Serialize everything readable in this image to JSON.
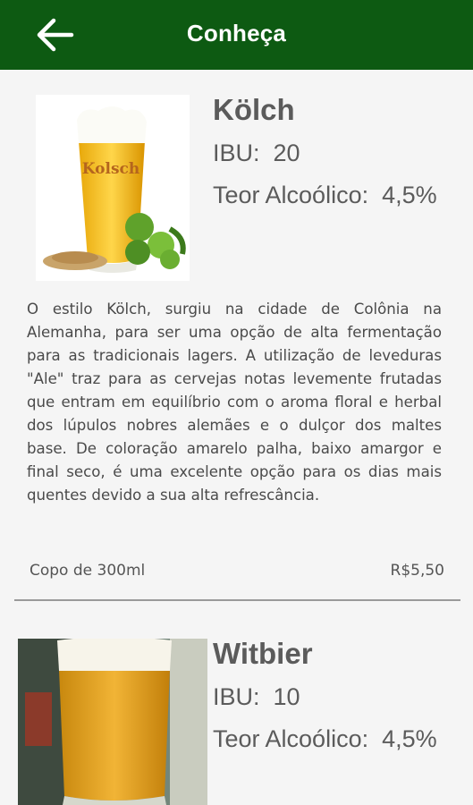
{
  "appbar": {
    "title": "Conheça"
  },
  "beers": [
    {
      "name": "Kölch",
      "ibu_label": "IBU:",
      "ibu_value": "20",
      "abv_label": "Teor Alcoólico:",
      "abv_value": "4,5%",
      "glass_text": "Kolsch",
      "description": "O estilo Kölch, surgiu na cidade de Colônia na Alemanha, para ser uma opção de alta fermentação para as tradicionais lagers. A utilização de leveduras \"Ale\" traz para as cervejas notas levemente frutadas que entram em equilíbrio com o aroma floral e herbal dos lúpulos nobres alemães e o dulçor dos maltes base. De coloração amarelo palha, baixo amargor e final seco, é uma excelente opção para os dias mais quentes devido a sua alta refrescância.",
      "serving": "Copo de 300ml",
      "price": "R$5,50"
    },
    {
      "name": "Witbier",
      "ibu_label": "IBU:",
      "ibu_value": "10",
      "abv_label": "Teor Alcoólico:",
      "abv_value": "4,5%"
    }
  ],
  "colors": {
    "appbar": "#0d5a12",
    "background": "#f5f5f5",
    "text": "#5b5b5b"
  }
}
